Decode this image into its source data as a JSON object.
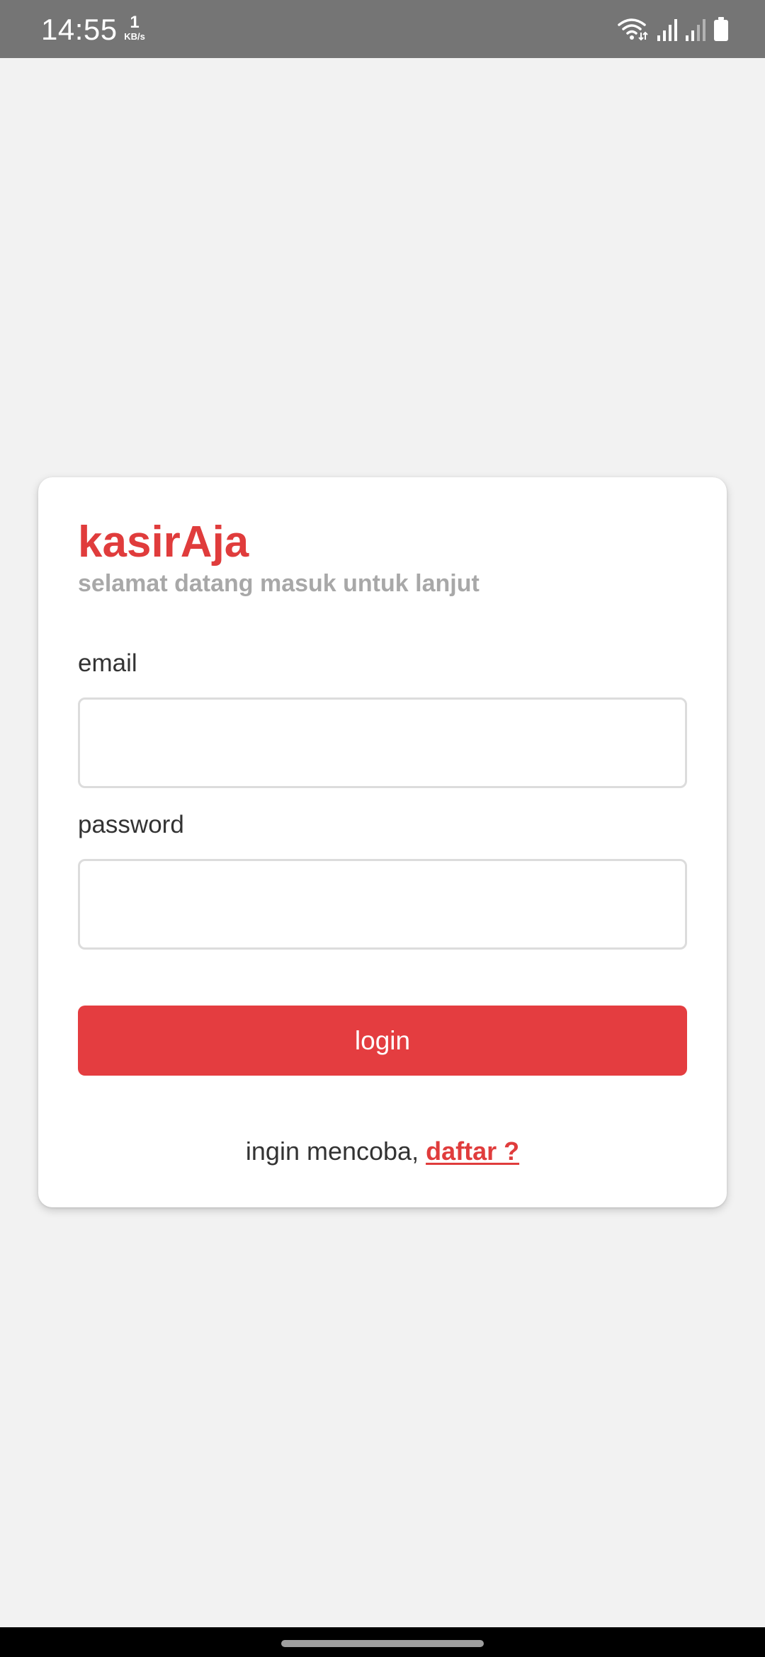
{
  "status_bar": {
    "time": "14:55",
    "net_speed_value": "1",
    "net_speed_unit": "KB/s",
    "icons": [
      "wifi-icon",
      "signal-icon",
      "signal-icon",
      "battery-icon"
    ]
  },
  "login": {
    "brand": "kasirAja",
    "subtitle": "selamat datang masuk untuk lanjut",
    "email_label": "email",
    "email_value": "",
    "password_label": "password",
    "password_value": "",
    "login_label": "login",
    "register_prompt": "ingin mencoba, ",
    "register_link": "daftar ?"
  },
  "colors": {
    "accent": "#e43d40",
    "status_bar": "#757575",
    "background": "#f2f2f2",
    "subtitle": "#a8a8a8"
  }
}
